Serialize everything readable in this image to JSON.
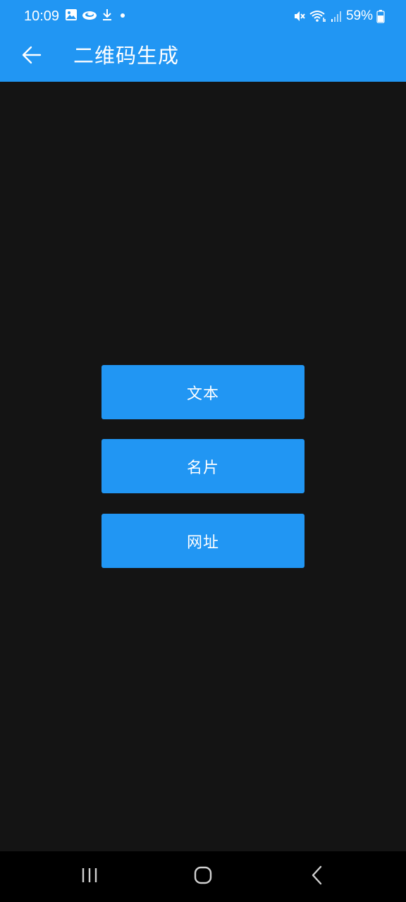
{
  "status_bar": {
    "time": "10:09",
    "battery_percent": "59%",
    "icons_left": [
      "gallery-icon",
      "cloud-icon",
      "download-icon",
      "dot-icon"
    ],
    "icons_right": [
      "mute-icon",
      "wifi-icon",
      "signal-icon",
      "battery-icon"
    ]
  },
  "app_bar": {
    "title": "二维码生成",
    "back_icon": "arrow-left-icon"
  },
  "main": {
    "buttons": [
      {
        "label": "文本"
      },
      {
        "label": "名片"
      },
      {
        "label": "网址"
      }
    ]
  },
  "nav_bar": {
    "items": [
      "recent-apps-icon",
      "home-icon",
      "back-icon"
    ]
  },
  "colors": {
    "primary": "#2196f3",
    "background": "#141414",
    "nav_background": "#000000",
    "text_on_primary": "#ffffff"
  }
}
